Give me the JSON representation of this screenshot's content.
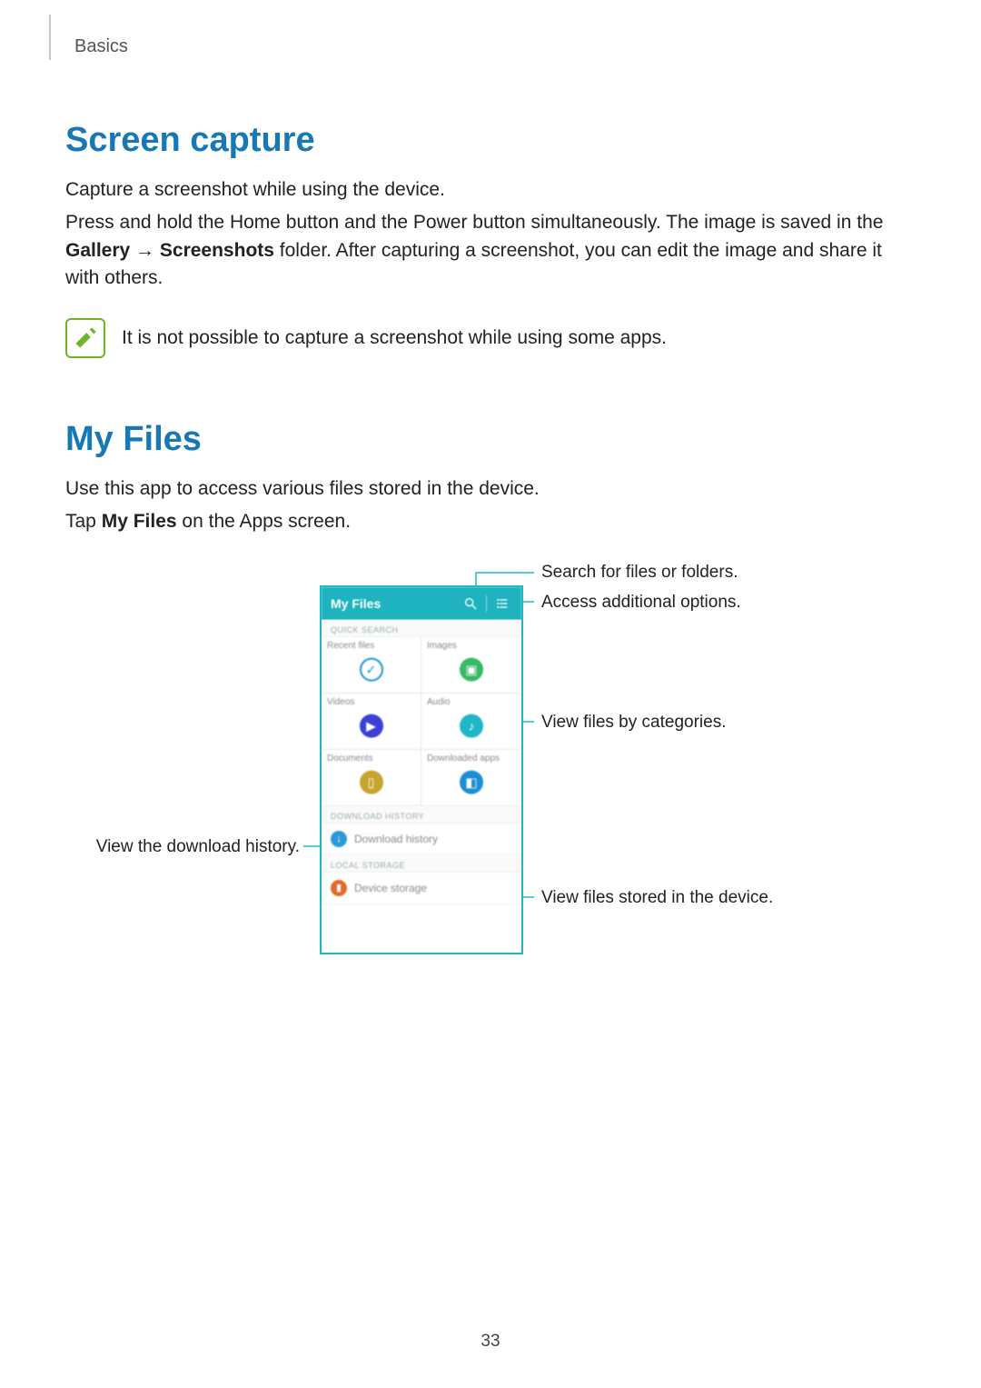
{
  "breadcrumb": "Basics",
  "screen_capture": {
    "heading": "Screen capture",
    "p1": "Capture a screenshot while using the device.",
    "p2_pre": "Press and hold the Home button and the Power button simultaneously. The image is saved in the ",
    "p2_bold1": "Gallery",
    "p2_arrow": " → ",
    "p2_bold2": "Screenshots",
    "p2_post": " folder. After capturing a screenshot, you can edit the image and share it with others.",
    "note": "It is not possible to capture a screenshot while using some apps."
  },
  "my_files": {
    "heading": "My Files",
    "p1": "Use this app to access various files stored in the device.",
    "p2_pre": "Tap ",
    "p2_bold": "My Files",
    "p2_post": " on the Apps screen."
  },
  "phone": {
    "title": "My Files",
    "quick_search_label": "QUICK SEARCH",
    "cells": {
      "recent": "Recent files",
      "images": "Images",
      "videos": "Videos",
      "audio": "Audio",
      "documents": "Documents",
      "downloaded_apps": "Downloaded apps"
    },
    "download_history_label": "DOWNLOAD HISTORY",
    "download_history_item": "Download history",
    "local_storage_label": "LOCAL STORAGE",
    "device_storage_item": "Device storage"
  },
  "callouts": {
    "search": "Search for files or folders.",
    "options": "Access additional options.",
    "categories": "View files by categories.",
    "download_history": "View the download history.",
    "device_storage": "View files stored in the device."
  },
  "page_number": "33"
}
